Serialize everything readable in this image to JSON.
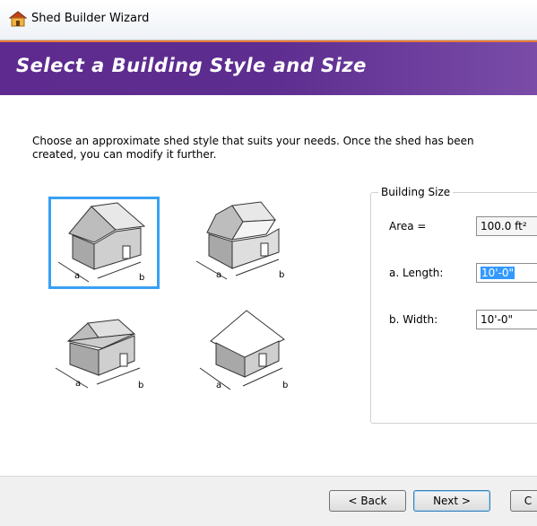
{
  "window": {
    "title": "Shed Builder Wizard"
  },
  "banner": {
    "heading": "Select a Building Style and Size"
  },
  "intro_text": "Choose an approximate shed style that suits your needs. Once the shed has been created, you can modify it further.",
  "styles": {
    "dim_a": "a",
    "dim_b": "b",
    "options": [
      {
        "name": "gable",
        "selected": true
      },
      {
        "name": "gambrel",
        "selected": false
      },
      {
        "name": "hip",
        "selected": false
      },
      {
        "name": "flat",
        "selected": false
      }
    ]
  },
  "building_size": {
    "legend": "Building Size",
    "area_label": "Area =",
    "area_value": "100.0 ft²",
    "length_label": "a. Length:",
    "length_value": "10'-0\"",
    "width_label": "b. Width:",
    "width_value": "10'-0\""
  },
  "buttons": {
    "back": "< Back",
    "next": "Next >",
    "cancel": "C"
  },
  "colors": {
    "banner": "#5e2a8f",
    "banner_accent": "#e77a38",
    "selection": "#39a0f4"
  }
}
